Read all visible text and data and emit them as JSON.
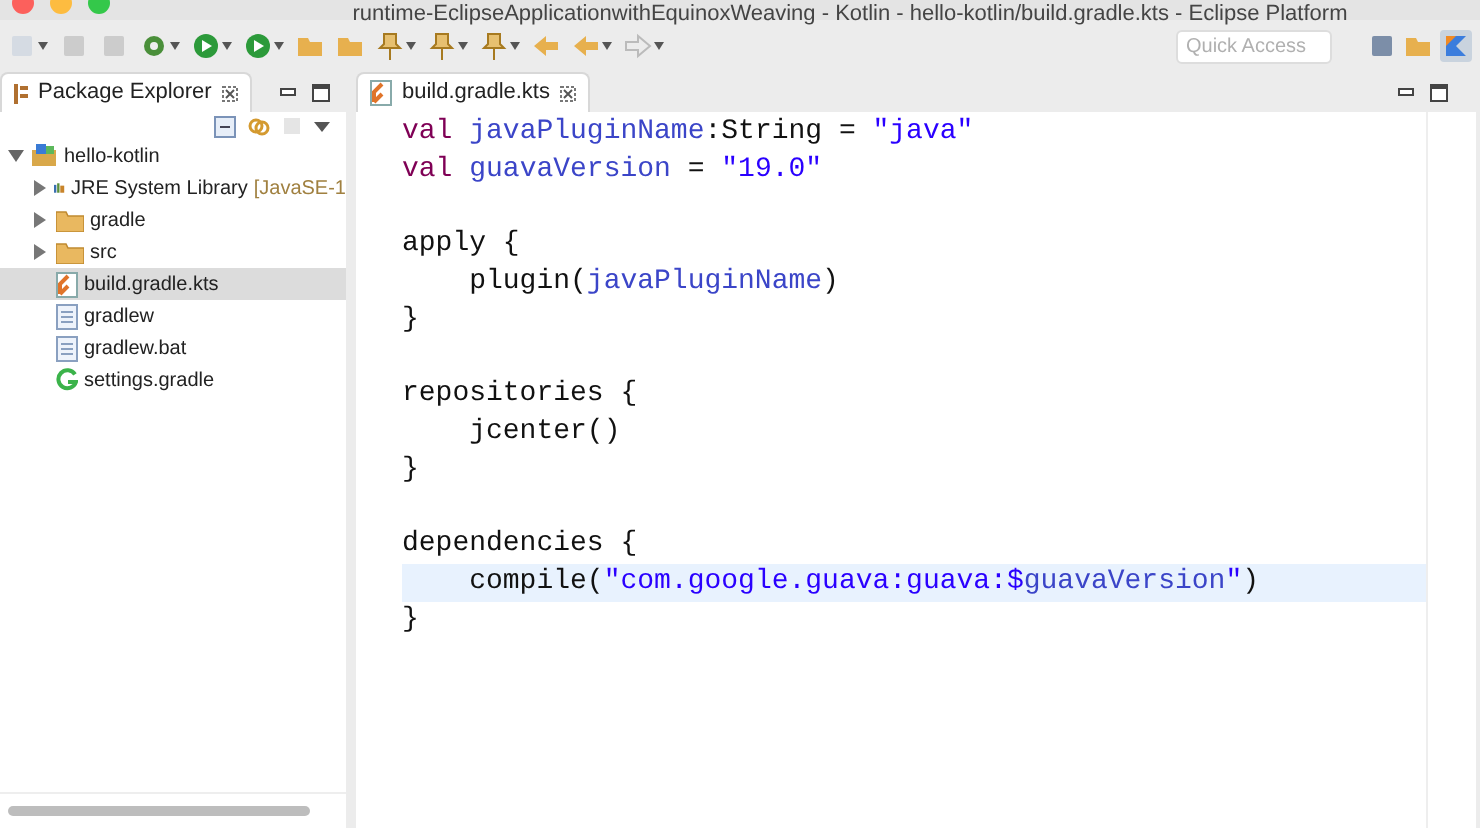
{
  "window": {
    "title": "runtime-EclipseApplicationwithEquinoxWeaving - Kotlin - hello-kotlin/build.gradle.kts - Eclipse Platform"
  },
  "toolbar": {
    "quick_access": {
      "placeholder": "Quick Access"
    }
  },
  "package_explorer": {
    "title": "Package Explorer",
    "tree": [
      {
        "label": "hello-kotlin",
        "kind": "project",
        "expanded": true,
        "selected": false,
        "children": [
          {
            "label": "JRE System Library",
            "suffix": "[JavaSE-1",
            "kind": "library",
            "expanded": false,
            "selected": false
          },
          {
            "label": "gradle",
            "kind": "folder",
            "expanded": false,
            "selected": false
          },
          {
            "label": "src",
            "kind": "folder",
            "expanded": false,
            "selected": false
          },
          {
            "label": "build.gradle.kts",
            "kind": "kts",
            "selected": true
          },
          {
            "label": "gradlew",
            "kind": "file",
            "selected": false
          },
          {
            "label": "gradlew.bat",
            "kind": "file",
            "selected": false
          },
          {
            "label": "settings.gradle",
            "kind": "gradle",
            "selected": false
          }
        ]
      }
    ]
  },
  "editor": {
    "tab": "build.gradle.kts",
    "lines": [
      {
        "current": false,
        "tokens": [
          {
            "kind": "keyword",
            "text": "val "
          },
          {
            "kind": "property",
            "text": "javaPluginName"
          },
          {
            "kind": "plain",
            "text": ":String = "
          },
          {
            "kind": "string",
            "text": "\"java\""
          }
        ]
      },
      {
        "current": false,
        "tokens": [
          {
            "kind": "keyword",
            "text": "val "
          },
          {
            "kind": "property",
            "text": "guavaVersion"
          },
          {
            "kind": "plain",
            "text": " = "
          },
          {
            "kind": "string",
            "text": "\"19.0\""
          }
        ]
      },
      {
        "current": false
      },
      {
        "current": false,
        "tokens": [
          {
            "kind": "plain",
            "text": "apply {"
          }
        ]
      },
      {
        "current": false,
        "tokens": [
          {
            "kind": "plain",
            "text": "    plugin("
          },
          {
            "kind": "property",
            "text": "javaPluginName"
          },
          {
            "kind": "plain",
            "text": ")"
          }
        ]
      },
      {
        "current": false,
        "tokens": [
          {
            "kind": "plain",
            "text": "}"
          }
        ]
      },
      {
        "current": false
      },
      {
        "current": false,
        "tokens": [
          {
            "kind": "plain",
            "text": "repositories {"
          }
        ]
      },
      {
        "current": false,
        "tokens": [
          {
            "kind": "plain",
            "text": "    jcenter()"
          }
        ]
      },
      {
        "current": false,
        "tokens": [
          {
            "kind": "plain",
            "text": "}"
          }
        ]
      },
      {
        "current": false
      },
      {
        "current": false,
        "tokens": [
          {
            "kind": "plain",
            "text": "dependencies {"
          }
        ]
      },
      {
        "current": true,
        "tokens": [
          {
            "kind": "plain",
            "text": "    compile("
          },
          {
            "kind": "string",
            "text": "\"com.google.guava:guava:$"
          },
          {
            "kind": "property",
            "text": "guavaVersion"
          },
          {
            "kind": "string",
            "text": "\""
          },
          {
            "kind": "plain",
            "text": ")"
          }
        ]
      },
      {
        "current": false,
        "tokens": [
          {
            "kind": "plain",
            "text": "}"
          }
        ]
      }
    ]
  }
}
